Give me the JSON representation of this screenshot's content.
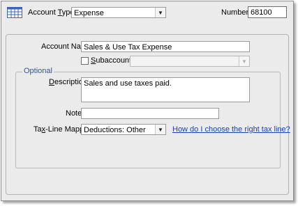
{
  "header": {
    "account_type_label_pre": "Account ",
    "account_type_label_u": "T",
    "account_type_label_post": "ype",
    "account_type_value": "Expense",
    "number_label": "Number",
    "number_value": "68100"
  },
  "form": {
    "account_name_label_pre": "Account Na",
    "account_name_label_u": "m",
    "account_name_label_post": "e",
    "account_name_value": "Sales & Use Tax Expense",
    "subaccount_label_u": "S",
    "subaccount_label_post": "ubaccount of",
    "subaccount_checked": false,
    "subaccount_value": ""
  },
  "optional": {
    "legend": "Optional",
    "description_label_u": "D",
    "description_label_post": "escription",
    "description_value": "Sales and use taxes paid.",
    "note_label": "Note",
    "note_value": "",
    "tax_line_label_pre": "Ta",
    "tax_line_label_u": "x",
    "tax_line_label_post": "-Line Mapping",
    "tax_line_value": "Deductions: Other",
    "tax_help_link": "How do I choose the right tax line?"
  },
  "icons": {
    "account_icon": "table-grid-icon",
    "dropdown_icon": "chevron-down-icon"
  },
  "colors": {
    "window_bg": "#ebebeb",
    "legend_color": "#2a55a8",
    "link_color": "#1a3fb0"
  }
}
